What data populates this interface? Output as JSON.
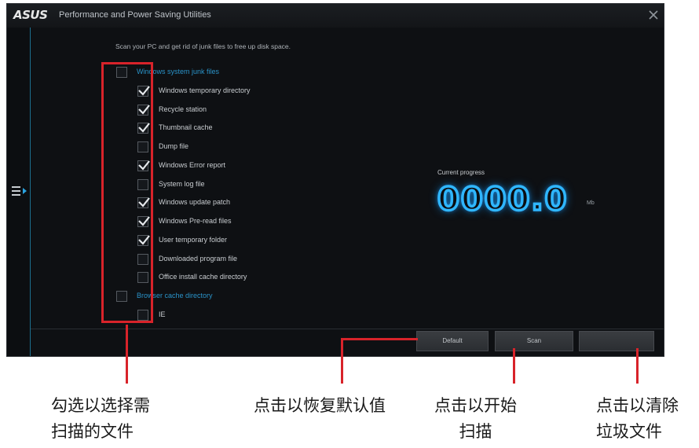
{
  "window": {
    "brand": "ASUS",
    "title": "Performance and Power Saving Utilities"
  },
  "instruction": "Scan your PC and get rid of junk files to free up disk space.",
  "checklist": [
    {
      "label": "Windows system junk files",
      "checked": false,
      "group": true
    },
    {
      "label": "Windows temporary directory",
      "checked": true,
      "group": false
    },
    {
      "label": "Recycle station",
      "checked": true,
      "group": false
    },
    {
      "label": "Thumbnail cache",
      "checked": true,
      "group": false
    },
    {
      "label": "Dump file",
      "checked": false,
      "group": false
    },
    {
      "label": "Windows Error report",
      "checked": true,
      "group": false
    },
    {
      "label": "System log file",
      "checked": false,
      "group": false
    },
    {
      "label": "Windows update patch",
      "checked": true,
      "group": false
    },
    {
      "label": "Windows Pre-read files",
      "checked": true,
      "group": false
    },
    {
      "label": "User temporary folder",
      "checked": true,
      "group": false
    },
    {
      "label": "Downloaded program file",
      "checked": false,
      "group": false
    },
    {
      "label": "Office install cache directory",
      "checked": false,
      "group": false
    },
    {
      "label": "Browser cache directory",
      "checked": false,
      "group": true
    },
    {
      "label": "IE",
      "checked": false,
      "group": false
    }
  ],
  "progress": {
    "label": "Current progress",
    "value": "0000.0",
    "unit": "Mb"
  },
  "buttons": {
    "default": "Default",
    "scan": "Scan",
    "clean": ""
  },
  "annotations": {
    "select": [
      "勾选以选择需",
      "扫描的文件"
    ],
    "default": [
      "点击以恢复默认值"
    ],
    "scan": [
      "点击以开始",
      "扫描"
    ],
    "clean": [
      "点击以清除",
      "垃圾文件"
    ]
  },
  "colors": {
    "accent": "#2fb6ff",
    "group_label": "#2a93c9",
    "annotation_red": "#d8232a",
    "window_bg": "#0e1013"
  }
}
